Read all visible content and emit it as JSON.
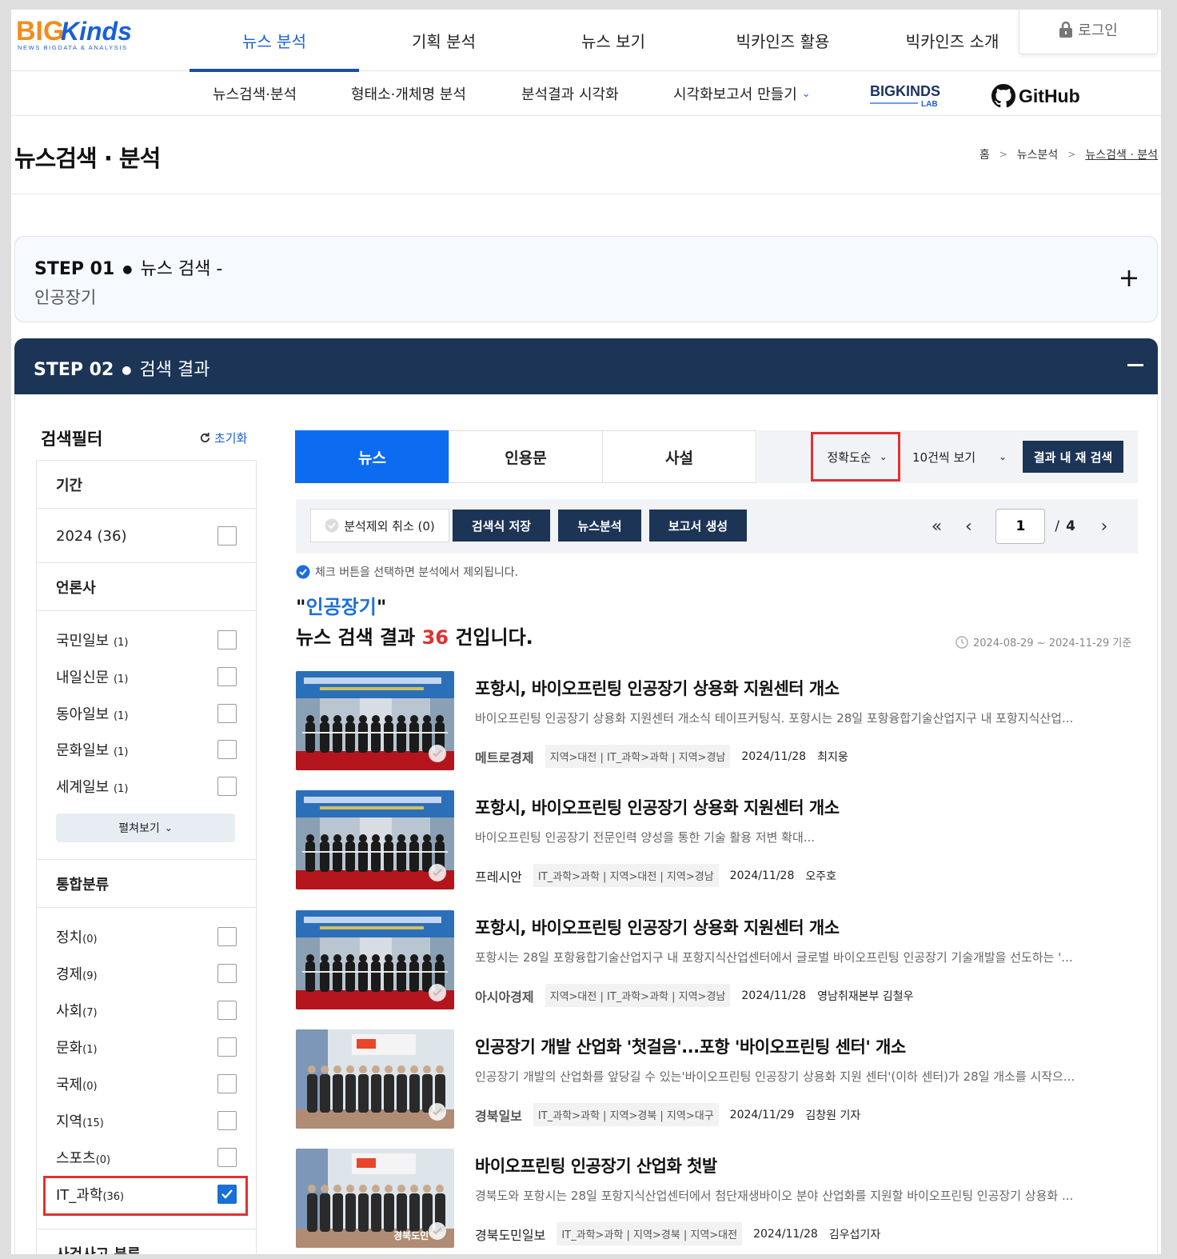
{
  "gnb": {
    "items": [
      {
        "label": "뉴스 분석",
        "active": true
      },
      {
        "label": "기획 분석"
      },
      {
        "label": "뉴스 보기"
      },
      {
        "label": "빅카인즈 활용"
      },
      {
        "label": "빅카인즈 소개"
      }
    ],
    "login": "로그인"
  },
  "logo": {
    "wordmark_big": "BIG",
    "wordmark_kinds": "Kinds",
    "tagline": "NEWS BIGDATA & ANALYSIS"
  },
  "subnav": {
    "items": [
      "뉴스검색·분석",
      "형태소·개체명 분석",
      "분석결과 시각화",
      "시각화보고서 만들기"
    ],
    "lab": "BIGKINDS",
    "lab_sub": "LAB",
    "github": "GitHub"
  },
  "page": {
    "title": "뉴스검색 · 분석",
    "breadcrumb": [
      "홈",
      "뉴스분석",
      "뉴스검색 · 분석"
    ]
  },
  "step1": {
    "num": "STEP 01",
    "name": "뉴스 검색 -",
    "keyword": "인공장기",
    "toggle": "+"
  },
  "step2": {
    "num": "STEP 02",
    "name": "검색 결과"
  },
  "filter": {
    "title": "검색필터",
    "reset": "초기화",
    "period": {
      "label": "기간",
      "items": [
        {
          "label": "2024 (36)",
          "checked": false
        }
      ]
    },
    "press": {
      "label": "언론사",
      "items": [
        {
          "name": "국민일보",
          "count": "(1)",
          "checked": false
        },
        {
          "name": "내일신문",
          "count": "(1)",
          "checked": false
        },
        {
          "name": "동아일보",
          "count": "(1)",
          "checked": false
        },
        {
          "name": "문화일보",
          "count": "(1)",
          "checked": false
        },
        {
          "name": "세계일보",
          "count": "(1)",
          "checked": false
        }
      ],
      "expand": "펼쳐보기"
    },
    "category": {
      "label": "통합분류",
      "items": [
        {
          "name": "정치",
          "count": "(0)",
          "checked": false
        },
        {
          "name": "경제",
          "count": "(9)",
          "checked": false
        },
        {
          "name": "사회",
          "count": "(7)",
          "checked": false
        },
        {
          "name": "문화",
          "count": "(1)",
          "checked": false
        },
        {
          "name": "국제",
          "count": "(0)",
          "checked": false
        },
        {
          "name": "지역",
          "count": "(15)",
          "checked": false
        },
        {
          "name": "스포츠",
          "count": "(0)",
          "checked": false
        },
        {
          "name": "IT_과학",
          "count": "(36)",
          "checked": true
        }
      ]
    },
    "incident": {
      "label": "사건사고 분류"
    }
  },
  "tabs": [
    "뉴스",
    "인용문",
    "사설"
  ],
  "controls": {
    "sort": "정확도순",
    "per_page": "10건씩 보기",
    "research": "결과 내 재 검색"
  },
  "actions": {
    "exclude": "분석제외 취소 (0)",
    "save": "검색식 저장",
    "analyze": "뉴스분석",
    "report": "보고서 생성"
  },
  "pager": {
    "current": "1",
    "total": "4"
  },
  "notice": "체크 버튼을 선택하면 분석에서 제외됩니다.",
  "result_summary": {
    "keyword": "인공장기",
    "prefix": "뉴스 검색 결과",
    "count": "36",
    "suffix": "건입니다.",
    "period": "2024-08-29 ~ 2024-11-29 기준"
  },
  "results": [
    {
      "title": "포항시, 바이오프린팅 인공장기 상용화 지원센터 개소",
      "summary": "바이오프린팅 인공장기 상용화 지원센터 개소식 테이프커팅식. 포항시는 28일 포항융합기술산업지구 내 포항지식산업...",
      "press": "메트로경제",
      "category": "지역>대전 | IT_과학>과학 | 지역>경남",
      "date": "2024/11/28",
      "author": "최지웅",
      "thumb": "banner"
    },
    {
      "title": "포항시, 바이오프린팅 인공장기 상용화 지원센터 개소",
      "summary": "바이오프린팅 인공장기 전문인력 양성을 통한 기술 활용 저변 확대...",
      "press": "프레시안",
      "category": "IT_과학>과학 | 지역>대전 | 지역>경남",
      "date": "2024/11/28",
      "author": "오주호",
      "thumb": "banner"
    },
    {
      "title": "포항시, 바이오프린팅 인공장기 상용화 지원센터 개소",
      "summary": "포항시는 28일 포항융합기술산업지구 내 포항지식산업센터에서 글로벌 바이오프린팅 인공장기 기술개발을 선도하는 '...",
      "press": "아시아경제",
      "category": "지역>대전 | IT_과학>과학 | 지역>경남",
      "date": "2024/11/28",
      "author": "영남취재본부 김철우",
      "thumb": "banner"
    },
    {
      "title": "인공장기 개발 산업화 '첫걸음'...포항 '바이오프린팅 센터' 개소",
      "summary": "인공장기 개발의 산업화를 앞당길 수 있는'바이오프린팅 인공장기 상용화 지원 센터'(이하 센터)가 28일 개소를 시작으...",
      "press": "경북일보",
      "category": "IT_과학>과학 | 지역>경북 | 지역>대구",
      "date": "2024/11/29",
      "author": "김창원 기자",
      "thumb": "group"
    },
    {
      "title": "바이오프린팅 인공장기 산업화 첫발",
      "summary": "경북도와 포항시는 28일 포항지식산업센터에서 첨단재생바이오 분야 산업화를 지원할 바이오프린팅 인공장기 상용화 ...",
      "press": "경북도민일보",
      "category": "IT_과학>과학 | 지역>경북 | 지역>대전",
      "date": "2024/11/28",
      "author": "김우섭기자",
      "thumb": "group2",
      "thumb_caption": "경북도민"
    }
  ],
  "colors": {
    "brand_navy": "#1c3557",
    "accent_blue": "#0b6cf2",
    "highlight_red": "#e03131"
  }
}
